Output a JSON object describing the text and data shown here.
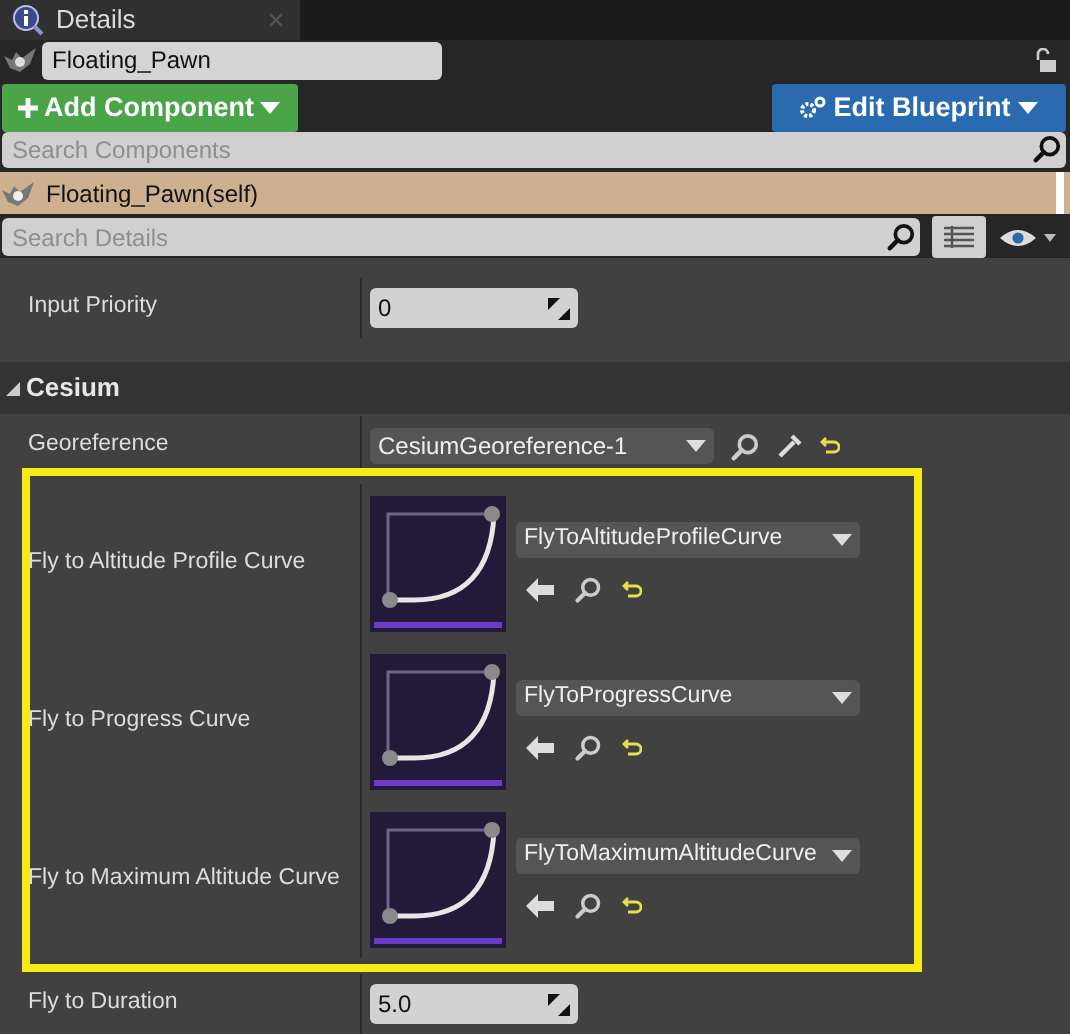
{
  "tab": {
    "title": "Details"
  },
  "actor": {
    "name": "Floating_Pawn"
  },
  "toolbar": {
    "add_button": "Add Component",
    "edit_button": "Edit Blueprint"
  },
  "component_search": {
    "placeholder": "Search Components"
  },
  "components": [
    {
      "label": "Floating_Pawn(self)",
      "selected": true
    }
  ],
  "details_search": {
    "placeholder": "Search Details"
  },
  "properties": [
    {
      "kind": "number",
      "label": "Input Priority",
      "value": "0"
    }
  ],
  "category": {
    "title": "Cesium",
    "expanded": true,
    "properties": [
      {
        "kind": "object",
        "label": "Georeference",
        "value": "CesiumGeoreference-1"
      },
      {
        "kind": "curve",
        "label": "Fly to Altitude Profile Curve",
        "value": "FlyToAltitudeProfileCurve"
      },
      {
        "kind": "curve",
        "label": "Fly to Progress Curve",
        "value": "FlyToProgressCurve"
      },
      {
        "kind": "curve",
        "label": "Fly to Maximum Altitude Curve",
        "value": "FlyToMaximumAltitudeCurve"
      },
      {
        "kind": "number",
        "label": "Fly to Duration",
        "value": "5.0"
      }
    ]
  }
}
